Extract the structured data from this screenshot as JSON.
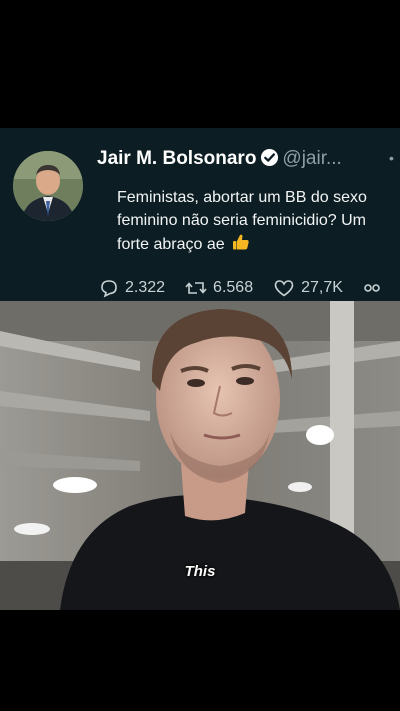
{
  "tweet": {
    "display_name": "Jair M. Bolsonaro",
    "handle": "@jair...",
    "text": "Feministas, abortar um BB do sexo feminino não seria feminicidio? Um forte abraço ae",
    "emoji_icon": "thumbs-up-icon",
    "stats": {
      "replies": "2.322",
      "retweets": "6.568",
      "likes": "27,7K"
    },
    "colors": {
      "background": "#0c1e23",
      "secondary_text": "#8f9ea3"
    }
  },
  "video": {
    "subtitle": "This"
  }
}
